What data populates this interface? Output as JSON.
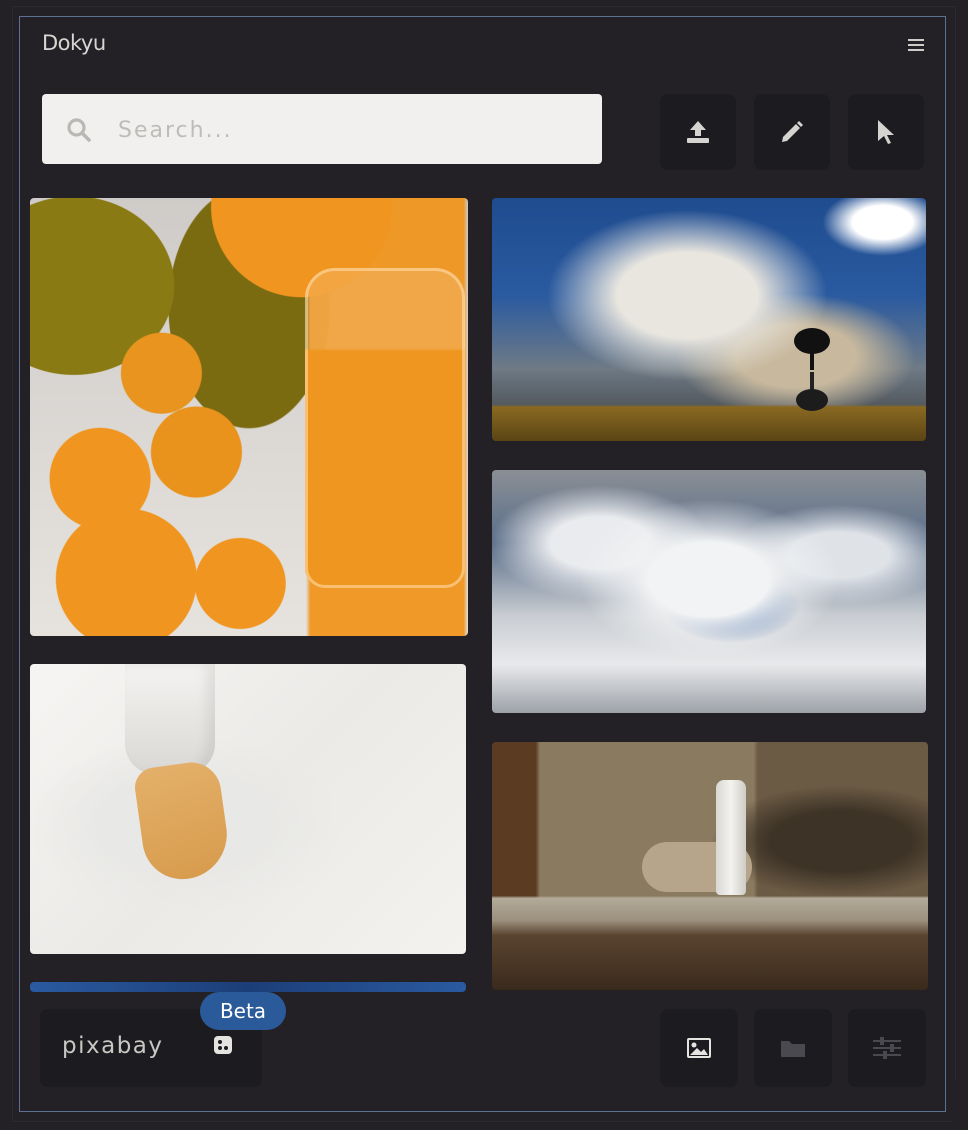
{
  "app": {
    "title": "Dokyu"
  },
  "search": {
    "placeholder": "Search..."
  },
  "toolbar": {
    "upload_icon": "upload-icon",
    "edit_icon": "pencil-icon",
    "select_icon": "cursor-icon"
  },
  "gallery": {
    "images": [
      {
        "subject": "oranges and orange juice"
      },
      {
        "subject": "lone tree under dramatic sky"
      },
      {
        "subject": "crashing ocean waves"
      },
      {
        "subject": "bare foot on white fabric"
      },
      {
        "subject": "man with water bottle at wooden table"
      }
    ]
  },
  "source": {
    "logo": "pixabay",
    "badge": "Beta",
    "dice_icon": "dice-icon"
  },
  "bottom_bar": {
    "image_icon": "image-icon",
    "folder_icon": "folder-icon",
    "sliders_icon": "sliders-icon"
  },
  "colors": {
    "background": "#232126",
    "panel_border": "#5a7193",
    "button_bg": "#1c1b1f",
    "badge": "#2a5a99",
    "search_bg": "#f1f0ee"
  }
}
